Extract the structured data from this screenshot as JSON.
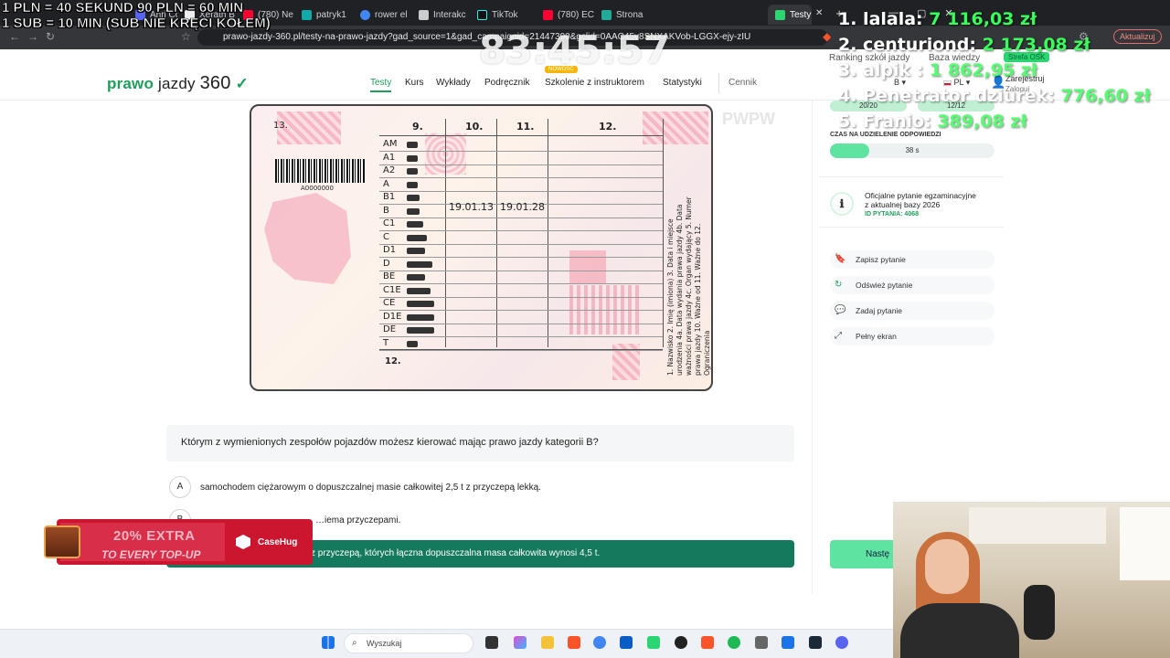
{
  "browser": {
    "tabs": [
      "Ahri Co",
      "Xerath B",
      "(780) Ne",
      "patryk1",
      "rower el",
      "Interakc",
      "TikTok",
      "(780) EC",
      "Strona",
      "Testy"
    ],
    "url": "prawo-jazdy-360.pl/testy-na-prawo-jazdy?gad_source=1&gad_campaignid=21447390&gclid=0AAC45v8SNXAKVob-LGGX-ejy-zIU",
    "update_label": "Aktualizuj"
  },
  "stream": {
    "rule1": "1 PLN = 40 SEKUND 90 PLN = 60 MIN",
    "rule2": "1 SUB = 10 MIN (SUB NIE KRĘCI KOŁEM)",
    "timer": "83:45:57",
    "donors": [
      {
        "name": "1. lalala:",
        "amount": "7 116,03 zł"
      },
      {
        "name": "2. centuriond:",
        "amount": "2 173,08 zł"
      },
      {
        "name": "3. alpik :",
        "amount": "1 862,95 zł"
      },
      {
        "name": "4. Penetrator dziurek:",
        "amount": "776,60 zł"
      },
      {
        "name": "5. Franio:",
        "amount": "389,08 zł"
      }
    ],
    "ad": {
      "line1": "20% EXTRA",
      "line2": "TO EVERY TOP-UP",
      "brand": "CaseHug"
    }
  },
  "site": {
    "logo_a": "prawo",
    "logo_b": " jazdy ",
    "logo_c": "360",
    "nav": [
      "Testy",
      "Kurs",
      "Wykłady",
      "Podręcznik",
      "Szkolenie z instruktorem",
      "Statystyki"
    ],
    "new_badge": "NOWOŚĆ",
    "pricing": "Cennik",
    "ranking": "Ranking szkół jazdy",
    "knowledge": "Baza wiedzy",
    "osk": "Strefa OSK",
    "category": "B",
    "language": "PL",
    "register": "Zarejestruj",
    "login": "Zaloguj"
  },
  "license": {
    "num13": "13.",
    "cols": [
      "9.",
      "10.",
      "11.",
      "12."
    ],
    "categories": [
      "AM",
      "A1",
      "A2",
      "A",
      "B1",
      "B",
      "C1",
      "C",
      "D1",
      "D",
      "BE",
      "C1E",
      "CE",
      "D1E",
      "DE",
      "T"
    ],
    "date_from": "19.01.13",
    "date_to": "19.01.28",
    "barcode_num": "A0000000",
    "bottom12": "12.",
    "side_text": "1. Nazwisko 2. Imię (imiona) 3. Data i miejsce urodzenia 4a. Data wydania prawa jazdy 4b. Data ważności prawa jazdy 4c. Organ wydający 5. Numer prawa jazdy 10. Ważne od 11. Ważne do 12. Ograniczenia",
    "pwpw": "PWPW"
  },
  "question": {
    "text": "Którym z wymienionych zespołów pojazdów możesz kierować mając prawo jazdy kategorii B?",
    "answers": [
      {
        "letter": "A",
        "text": "samochodem ciężarowym o dopuszczalnej masie całkowitej 2,5 t z przyczepą lekką."
      },
      {
        "letter": "B",
        "text": "…iema przyczepami."
      },
      {
        "letter": "C",
        "text": "z przyczepą, których łączna dopuszczalna masa całkowita wynosi 4,5 t."
      }
    ]
  },
  "sidebar": {
    "counter1": "20/20",
    "counter2": "12/12",
    "time_label": "CZAS NA UDZIELENIE ODPOWIEDZI",
    "time_value": "38 s",
    "time_fraction": 0.24,
    "info_line1": "Oficjalne pytanie egzaminacyjne",
    "info_line2": "z aktualnej bazy 2026",
    "info_id": "ID PYTANIA: 4068",
    "actions": [
      "Zapisz pytanie",
      "Odśwież pytanie",
      "Zadaj pytanie",
      "Pełny ekran"
    ],
    "next_label": "Nastę"
  },
  "taskbar": {
    "search_placeholder": "Wyszukaj"
  },
  "colors": {
    "brand_green": "#1e9e5a",
    "answer_selected": "#157a5d",
    "next_button": "#5fe3a1"
  }
}
